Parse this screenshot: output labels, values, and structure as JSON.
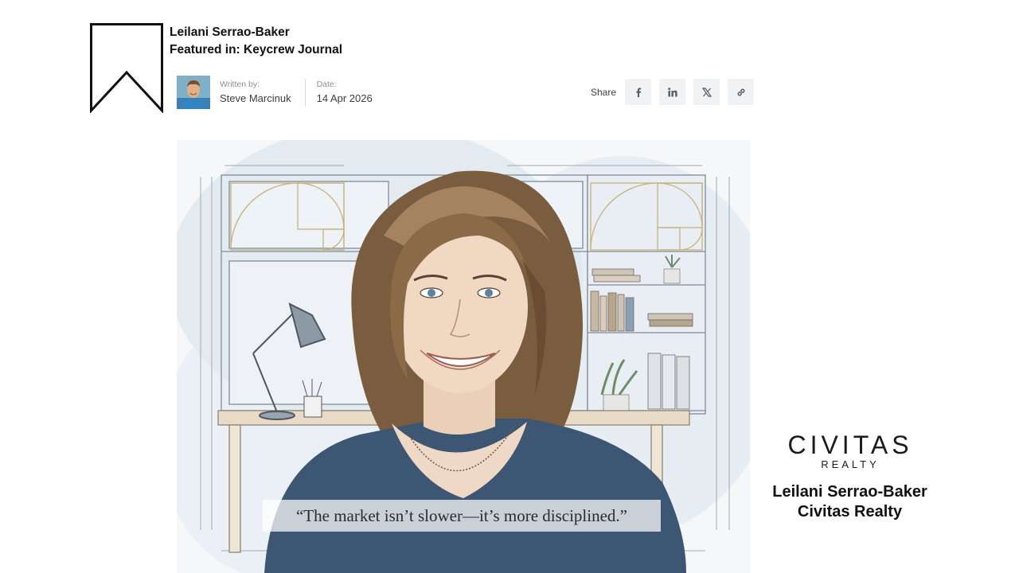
{
  "header": {
    "title": "Leilani Serrao-Baker",
    "featured": "Featured in: Keycrew Journal"
  },
  "meta": {
    "author_label": "Written by:",
    "author_name": "Steve Marcinuk",
    "date_label": "Date:",
    "date_value": "14 Apr 2026"
  },
  "share": {
    "label": "Share",
    "buttons": [
      "facebook-icon",
      "linkedin-icon",
      "x-icon",
      "link-icon"
    ]
  },
  "hero": {
    "quote": "“The market isn’t slower—it’s more disciplined.”"
  },
  "brand": {
    "logo_primary": "CIVITAS",
    "logo_secondary": "REALTY",
    "person_name": "Leilani Serrao-Baker",
    "company_name": "Civitas Realty"
  },
  "colors": {
    "accent_gold": "#c9b27a",
    "sketch_blue": "#b9cad9",
    "hair": "#7a5c3e",
    "top_blue": "#3d5673"
  }
}
